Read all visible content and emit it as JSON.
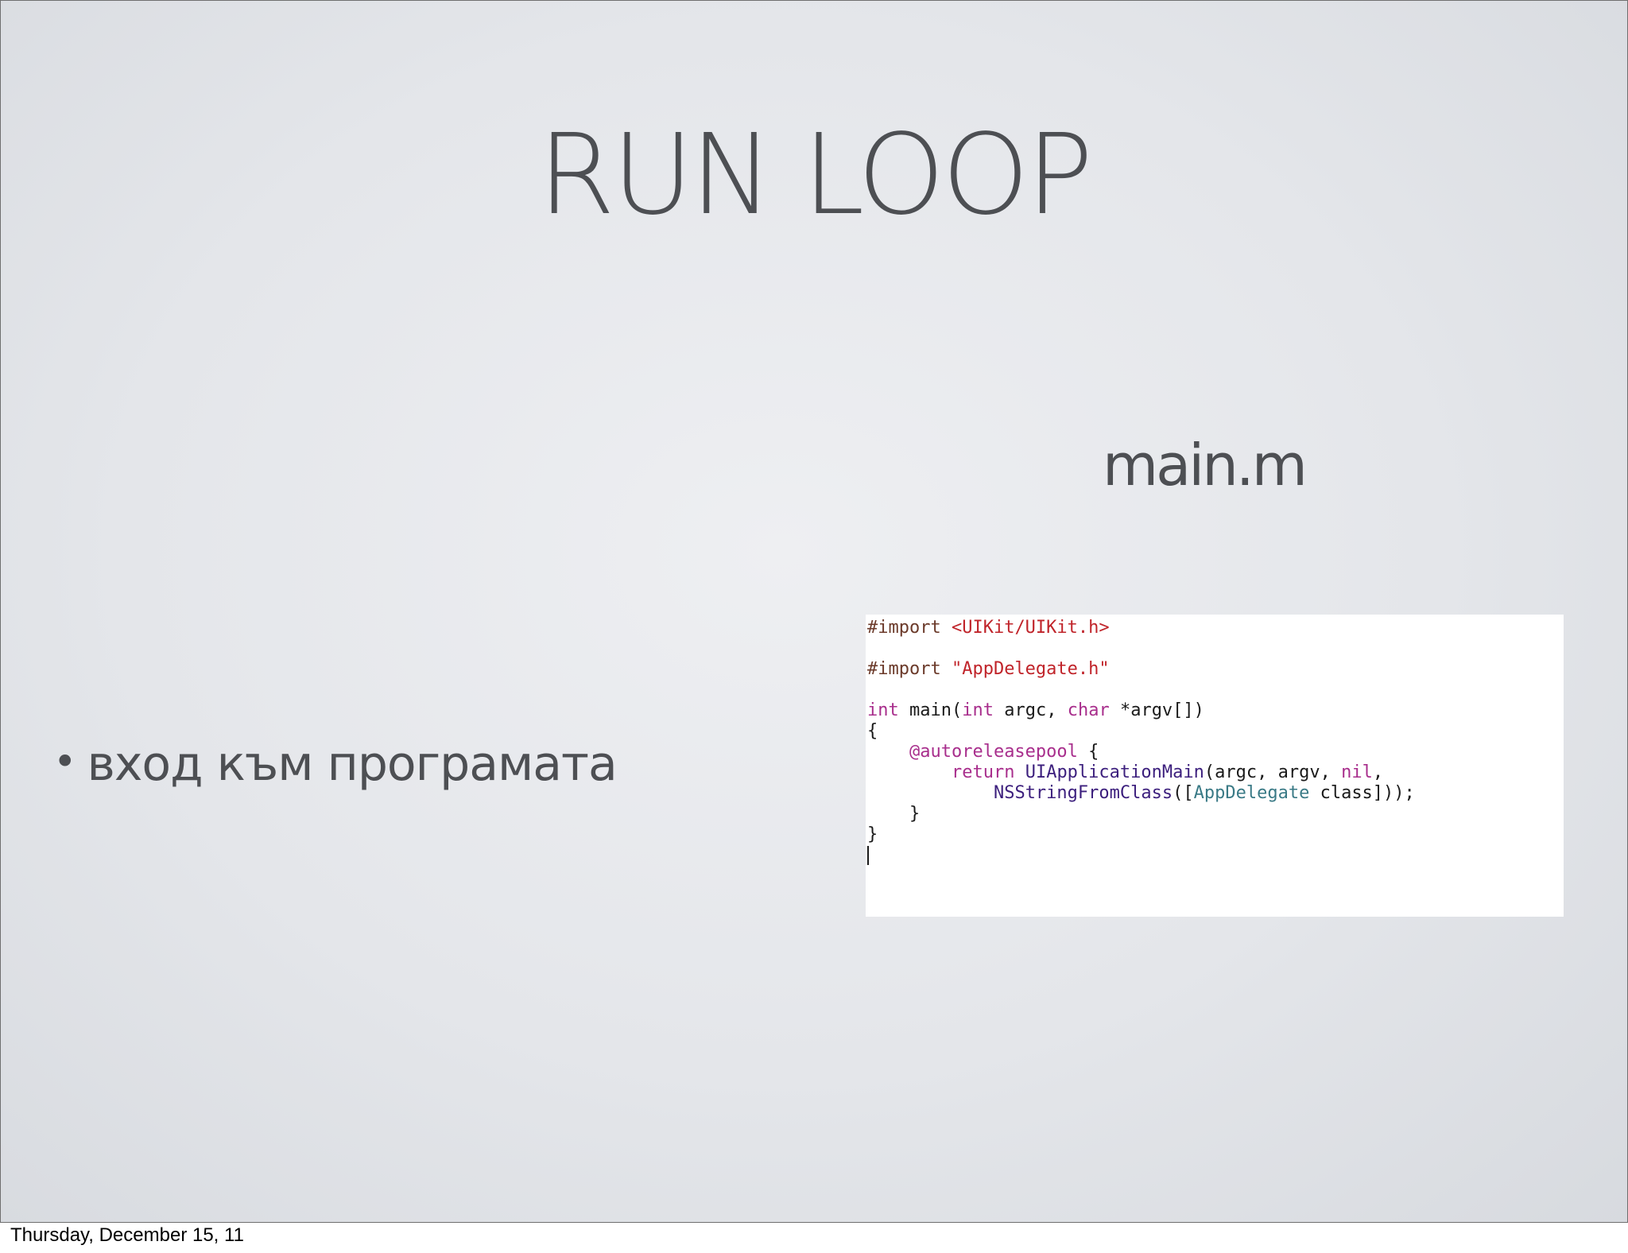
{
  "slide": {
    "title": "RUN LOOP",
    "file_label": "main.m",
    "bullet": "вход към програмата"
  },
  "code": {
    "line1": {
      "pp": "#import",
      "path": "<UIKit/UIKit.h>"
    },
    "line2": {
      "pp": "#import",
      "path": "\"AppDelegate.h\""
    },
    "line3": {
      "t1": "int",
      "fn": "main(",
      "t2": "int",
      "a1": "argc,",
      "t3": "char",
      "a2": "*argv[])"
    },
    "line4": "{",
    "line5": {
      "kw": "@autoreleasepool",
      "brace": "{"
    },
    "line6": {
      "kw": "return",
      "fn": "UIApplicationMain",
      "args": "(argc, argv,",
      "nil": "nil",
      "comma": ","
    },
    "line7": {
      "fn": "NSStringFromClass",
      "open": "([",
      "cls": "AppDelegate",
      "rest": "class]));"
    },
    "line8": "}",
    "line9": "}"
  },
  "footer": {
    "date": "Thursday, December 15, 11"
  }
}
